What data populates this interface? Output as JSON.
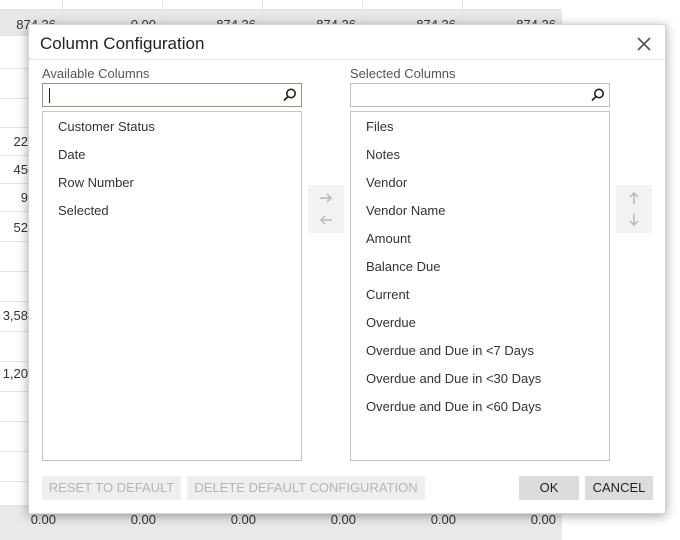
{
  "background": {
    "top_row": [
      "874.36",
      "0.00",
      "874.36",
      "874.36",
      "874.36",
      "874.36"
    ],
    "left_values": [
      "22",
      "45",
      "9",
      "52",
      "3,58",
      "1,20"
    ],
    "bottom_row": [
      "0.00",
      "0.00",
      "0.00",
      "0.00",
      "0.00",
      "0.00"
    ]
  },
  "dialog": {
    "title": "Column Configuration",
    "available": {
      "label": "Available Columns",
      "search_value": "",
      "items": [
        "Customer Status",
        "Date",
        "Row Number",
        "Selected"
      ]
    },
    "selected": {
      "label": "Selected Columns",
      "search_value": "",
      "items": [
        "Files",
        "Notes",
        "Vendor",
        "Vendor Name",
        "Amount",
        "Balance Due",
        "Current",
        "Overdue",
        "Overdue and Due in <7 Days",
        "Overdue and Due in <30 Days",
        "Overdue and Due in <60 Days"
      ]
    },
    "buttons": {
      "reset": "RESET TO DEFAULT",
      "delete": "DELETE DEFAULT CONFIGURATION",
      "ok": "OK",
      "cancel": "CANCEL"
    }
  },
  "icons": {
    "close": "close-icon",
    "search": "search-icon",
    "move_right": "arrow-right-icon",
    "move_left": "arrow-left-icon",
    "move_up": "arrow-up-icon",
    "move_down": "arrow-down-icon"
  }
}
